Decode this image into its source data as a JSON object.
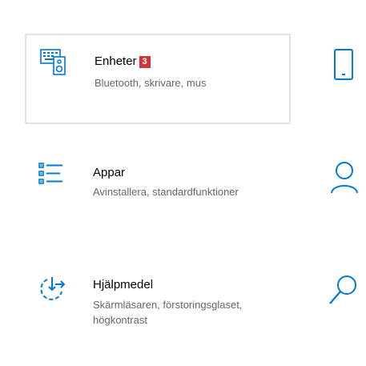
{
  "tiles": [
    {
      "title": "Enheter",
      "badge": "3",
      "description": "Bluetooth, skrivare, mus",
      "icon": "devices-icon",
      "selected": true
    },
    {
      "title": "Appar",
      "description": "Avinstallera, standardfunktioner",
      "icon": "apps-list-icon",
      "selected": false
    },
    {
      "title": "Hjälpmedel",
      "description_line1": "Skärmläsaren, förstoringsglaset,",
      "description_line2": "högkontrast",
      "icon": "ease-of-access-icon",
      "selected": false
    }
  ],
  "side_icons": [
    "phone-icon",
    "person-icon",
    "search-icon"
  ],
  "colors": {
    "accent": "#0078d7",
    "text": "#000000",
    "secondary_text": "#666666",
    "badge": "#d13438",
    "selected_border": "#e3e3e3"
  }
}
